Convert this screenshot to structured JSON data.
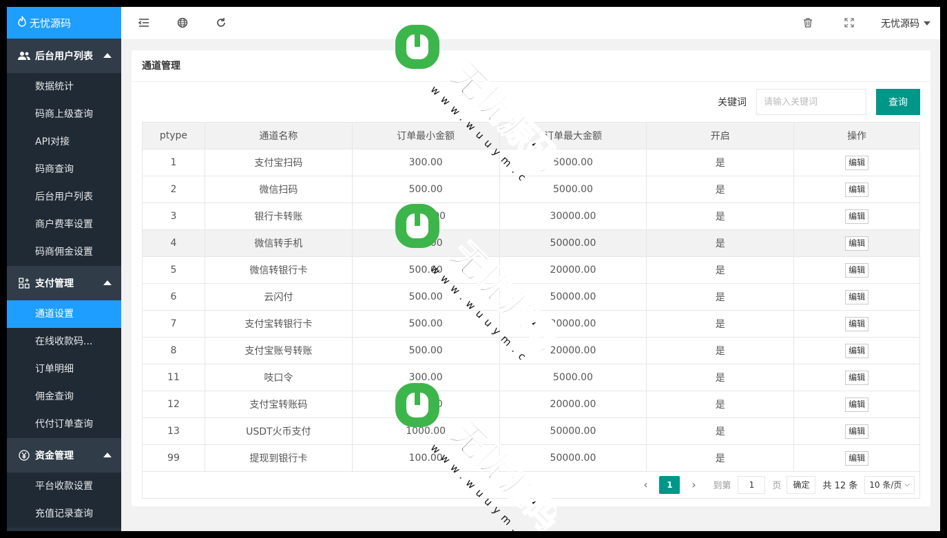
{
  "app": {
    "logo_text": "无忧源码"
  },
  "sidebar": {
    "groups": [
      {
        "title": "后台用户列表",
        "icon": "users-icon",
        "items": [
          "数据统计",
          "码商上级查询",
          "API对接",
          "码商查询",
          "后台用户列表",
          "商户费率设置",
          "码商佣金设置"
        ]
      },
      {
        "title": "支付管理",
        "icon": "apps-icon",
        "items": [
          "通道设置",
          "在线收款码...",
          "订单明细",
          "佣金查询",
          "代付订单查询"
        ]
      },
      {
        "title": "资金管理",
        "icon": "yen-icon",
        "items": [
          "平台收款设置",
          "充值记录查询"
        ]
      }
    ],
    "active_item": "通道设置"
  },
  "header": {
    "user_name": "无忧源码",
    "icons": [
      "menu-fold-icon",
      "globe-icon",
      "refresh-icon",
      "trash-icon",
      "fullscreen-icon"
    ]
  },
  "card": {
    "title": "通道管理"
  },
  "search": {
    "label": "关键词",
    "placeholder": "请输入关键词",
    "button": "查询"
  },
  "table": {
    "columns": [
      "ptype",
      "通道名称",
      "订单最小金额",
      "订单最大金额",
      "开启",
      "操作"
    ],
    "edit_label": "编辑",
    "rows": [
      [
        "1",
        "支付宝扫码",
        "300.00",
        "5000.00",
        "是"
      ],
      [
        "2",
        "微信扫码",
        "500.00",
        "5000.00",
        "是"
      ],
      [
        "3",
        "银行卡转账",
        "1000.00",
        "30000.00",
        "是"
      ],
      [
        "4",
        "微信转手机",
        "500.00",
        "50000.00",
        "是"
      ],
      [
        "5",
        "微信转银行卡",
        "500.00",
        "20000.00",
        "是"
      ],
      [
        "6",
        "云闪付",
        "500.00",
        "50000.00",
        "是"
      ],
      [
        "7",
        "支付宝转银行卡",
        "500.00",
        "20000.00",
        "是"
      ],
      [
        "8",
        "支付宝账号转账",
        "500.00",
        "20000.00",
        "是"
      ],
      [
        "11",
        "吱口令",
        "300.00",
        "5000.00",
        "是"
      ],
      [
        "12",
        "支付宝转账码",
        "500.00",
        "20000.00",
        "是"
      ],
      [
        "13",
        "USDT火币支付",
        "1000.00",
        "50000.00",
        "是"
      ],
      [
        "99",
        "提现到银行卡",
        "100.00",
        "50000.00",
        "是"
      ]
    ],
    "highlight_row": 3
  },
  "pagination": {
    "current": "1",
    "goto_label": "到第",
    "goto_value": "1",
    "page_unit": "页",
    "confirm": "确定",
    "total": "共 12 条",
    "page_size": "10 条/页"
  },
  "watermark": {
    "title": "无忧源码",
    "url": "www.wuuym.com"
  }
}
